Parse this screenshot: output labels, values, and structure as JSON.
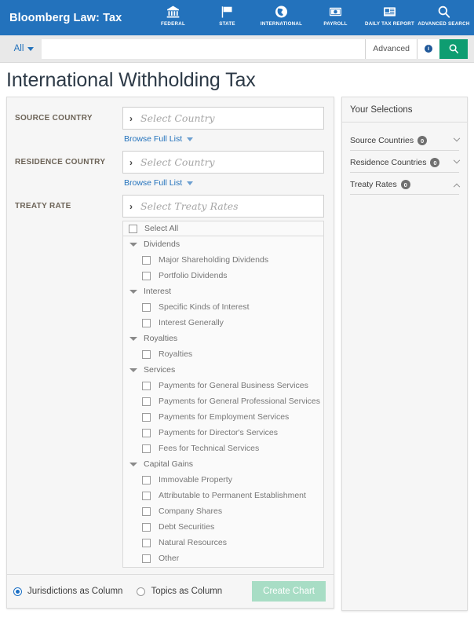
{
  "header": {
    "brand": "Bloomberg Law: Tax",
    "brand_bg": "#2372bc",
    "nav": [
      {
        "label": "FEDERAL",
        "icon": "bank-icon"
      },
      {
        "label": "STATE",
        "icon": "flag-icon"
      },
      {
        "label": "INTERNATIONAL",
        "icon": "globe-icon"
      },
      {
        "label": "PAYROLL",
        "icon": "money-icon"
      },
      {
        "label": "DAILY TAX REPORT",
        "icon": "newspaper-icon"
      },
      {
        "label": "ADVANCED SEARCH",
        "icon": "search-icon"
      }
    ]
  },
  "search": {
    "scope_label": "All",
    "placeholder": "",
    "value": "",
    "advanced_label": "Advanced",
    "info_glyph": "i",
    "search_button_color": "#0e9d71"
  },
  "page": {
    "title": "International Withholding Tax"
  },
  "form": {
    "source_country": {
      "label": "SOURCE COUNTRY",
      "placeholder": "Select Country",
      "value": "",
      "browse_label": "Browse Full List"
    },
    "residence_country": {
      "label": "RESIDENCE COUNTRY",
      "placeholder": "Select Country",
      "value": "",
      "browse_label": "Browse Full List"
    },
    "treaty_rate": {
      "label": "TREATY RATE",
      "placeholder": "Select Treaty Rates",
      "value": ""
    }
  },
  "tree": {
    "select_all_label": "Select All",
    "select_all_checked": false,
    "groups": [
      {
        "label": "Dividends",
        "expanded": true,
        "items": [
          {
            "label": "Major Shareholding Dividends",
            "checked": false
          },
          {
            "label": "Portfolio Dividends",
            "checked": false
          }
        ]
      },
      {
        "label": "Interest",
        "expanded": true,
        "items": [
          {
            "label": "Specific Kinds of Interest",
            "checked": false
          },
          {
            "label": "Interest Generally",
            "checked": false
          }
        ]
      },
      {
        "label": "Royalties",
        "expanded": true,
        "items": [
          {
            "label": "Royalties",
            "checked": false
          }
        ]
      },
      {
        "label": "Services",
        "expanded": true,
        "items": [
          {
            "label": "Payments for General Business Services",
            "checked": false
          },
          {
            "label": "Payments for General Professional Services",
            "checked": false
          },
          {
            "label": "Payments for Employment Services",
            "checked": false
          },
          {
            "label": "Payments for Director's Services",
            "checked": false
          },
          {
            "label": "Fees for Technical Services",
            "checked": false
          }
        ]
      },
      {
        "label": "Capital Gains",
        "expanded": true,
        "items": [
          {
            "label": "Immovable Property",
            "checked": false
          },
          {
            "label": "Attributable to Permanent Establishment",
            "checked": false
          },
          {
            "label": "Company Shares",
            "checked": false
          },
          {
            "label": "Debt Securities",
            "checked": false
          },
          {
            "label": "Natural Resources",
            "checked": false
          },
          {
            "label": "Other",
            "checked": false
          }
        ]
      }
    ]
  },
  "bottom": {
    "option_jurisdictions": "Jurisdictions as Column",
    "option_topics": "Topics as Column",
    "selected_option": "jurisdictions",
    "create_chart_label": "Create Chart",
    "create_chart_color": "#a8ddc5"
  },
  "selections": {
    "title": "Your Selections",
    "sections": [
      {
        "label": "Source Countries",
        "count": "0",
        "expanded": false
      },
      {
        "label": "Residence Countries",
        "count": "0",
        "expanded": false
      },
      {
        "label": "Treaty Rates",
        "count": "0",
        "expanded": true
      }
    ]
  }
}
